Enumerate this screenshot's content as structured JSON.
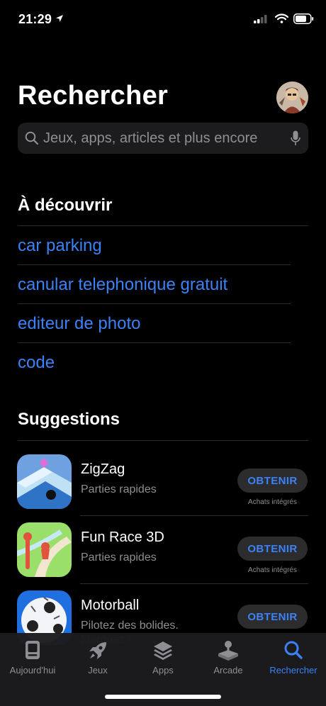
{
  "status_bar": {
    "time": "21:29"
  },
  "header": {
    "title": "Rechercher"
  },
  "search": {
    "placeholder": "Jeux, apps, articles et plus encore"
  },
  "discover": {
    "heading": "À découvrir",
    "items": [
      "car parking",
      "canular telephonique gratuit",
      "editeur de photo",
      "code"
    ]
  },
  "suggestions": {
    "heading": "Suggestions",
    "apps": [
      {
        "name": "ZigZag",
        "subtitle": "Parties rapides",
        "button": "OBTENIR",
        "note": "Achats intégrés"
      },
      {
        "name": "Fun Race 3D",
        "subtitle": "Parties rapides",
        "button": "OBTENIR",
        "note": "Achats intégrés"
      },
      {
        "name": "Motorball",
        "subtitle": "Pilotez des bolides. Marquez !",
        "button": "OBTENIR"
      }
    ]
  },
  "tabs": [
    {
      "label": "Aujourd'hui",
      "icon": "today-icon"
    },
    {
      "label": "Jeux",
      "icon": "rocket-icon"
    },
    {
      "label": "Apps",
      "icon": "layers-icon"
    },
    {
      "label": "Arcade",
      "icon": "joystick-icon"
    },
    {
      "label": "Rechercher",
      "icon": "search-icon",
      "active": true
    }
  ],
  "colors": {
    "accent": "#3b82f6",
    "background": "#000000",
    "secondary_text": "#8e8e93"
  }
}
